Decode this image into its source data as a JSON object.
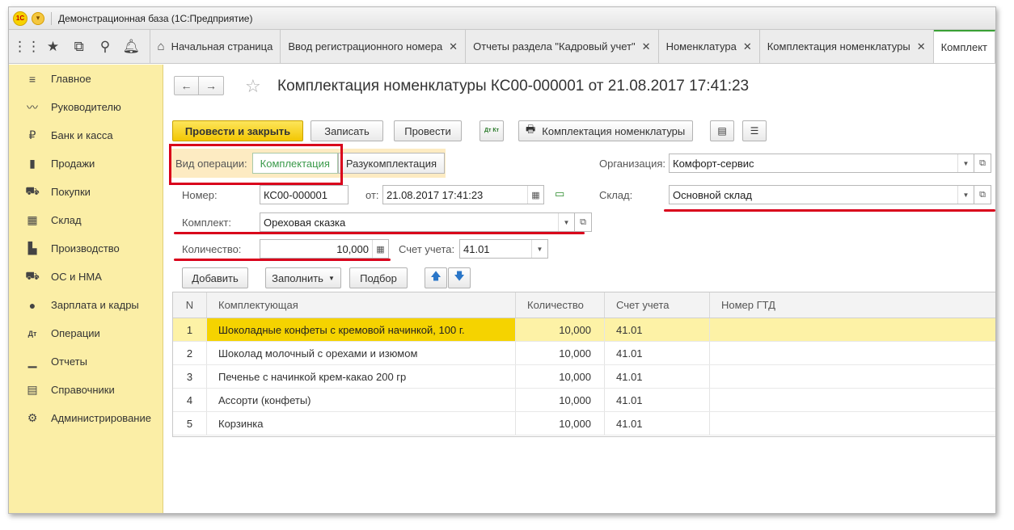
{
  "window": {
    "title": "Демонстрационная база  (1С:Предприятие)",
    "logo_text": "1С"
  },
  "tabs": [
    {
      "label": "Начальная страница"
    },
    {
      "label": "Ввод регистрационного номера"
    },
    {
      "label": "Отчеты раздела \"Кадровый учет\""
    },
    {
      "label": "Номенклатура"
    },
    {
      "label": "Комплектация номенклатуры"
    },
    {
      "label": "Комплект"
    }
  ],
  "sidebar": {
    "items": [
      {
        "label": "Главное",
        "icon": "≡"
      },
      {
        "label": "Руководителю",
        "icon": "〰"
      },
      {
        "label": "Банк и касса",
        "icon": "₽"
      },
      {
        "label": "Продажи",
        "icon": "▮"
      },
      {
        "label": "Покупки",
        "icon": "⛟"
      },
      {
        "label": "Склад",
        "icon": "▦"
      },
      {
        "label": "Производство",
        "icon": "▙"
      },
      {
        "label": "ОС и НМА",
        "icon": "⛟"
      },
      {
        "label": "Зарплата и кадры",
        "icon": "●"
      },
      {
        "label": "Операции",
        "icon": "Дт"
      },
      {
        "label": "Отчеты",
        "icon": "▁"
      },
      {
        "label": "Справочники",
        "icon": "▤"
      },
      {
        "label": "Администрирование",
        "icon": "⚙"
      }
    ]
  },
  "doc": {
    "title": "Комплектация номенклатуры КС00-000001 от 21.08.2017 17:41:23",
    "toolbar": {
      "post_close": "Провести и закрыть",
      "save": "Записать",
      "post": "Провести",
      "dtkt": "Дт Кт",
      "print": "Комплектация номенклатуры"
    },
    "operation_label": "Вид операции:",
    "operation_options": [
      "Комплектация",
      "Разукомплектация"
    ],
    "org_label": "Организация:",
    "org_value": "Комфорт-сервис",
    "number_label": "Номер:",
    "number_value": "КС00-000001",
    "date_label": "от:",
    "date_value": "21.08.2017 17:41:23",
    "warehouse_label": "Склад:",
    "warehouse_value": "Основной склад",
    "kit_label": "Комплект:",
    "kit_value": "Ореховая сказка",
    "qty_label": "Количество:",
    "qty_value": "10,000",
    "account_label": "Счет учета:",
    "account_value": "41.01",
    "table_toolbar": {
      "add": "Добавить",
      "fill": "Заполнить",
      "select": "Подбор"
    },
    "table": {
      "columns": [
        "N",
        "Комплектующая",
        "Количество",
        "Счет учета",
        "Номер ГТД"
      ],
      "rows": [
        {
          "n": "1",
          "name": "Шоколадные конфеты с кремовой начинкой, 100 г.",
          "qty": "10,000",
          "acc": "41.01",
          "gtd": ""
        },
        {
          "n": "2",
          "name": "Шоколад молочный с орехами и изюмом",
          "qty": "10,000",
          "acc": "41.01",
          "gtd": ""
        },
        {
          "n": "3",
          "name": "Печенье с начинкой крем-какао 200 гр",
          "qty": "10,000",
          "acc": "41.01",
          "gtd": ""
        },
        {
          "n": "4",
          "name": "Ассорти (конфеты)",
          "qty": "10,000",
          "acc": "41.01",
          "gtd": ""
        },
        {
          "n": "5",
          "name": "Корзинка",
          "qty": "10,000",
          "acc": "41.01",
          "gtd": ""
        }
      ]
    }
  },
  "colors": {
    "accent_yellow": "#f3c703",
    "sidebar_bg": "#fbeea6",
    "highlight_red": "#d9001b",
    "active_tab_green": "#3aa035"
  }
}
